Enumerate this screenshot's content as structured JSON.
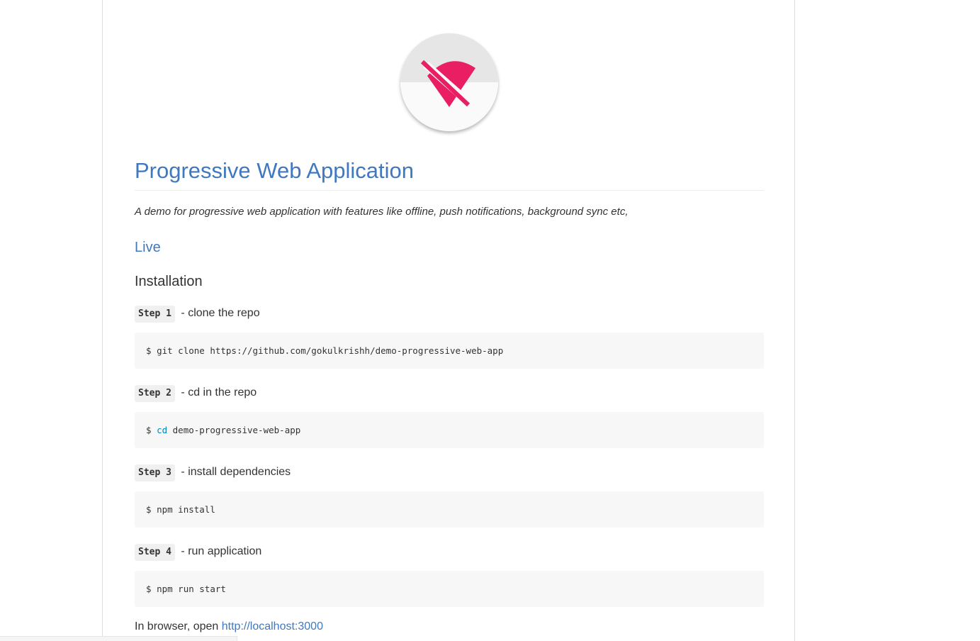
{
  "readme": {
    "title": "Progressive Web Application",
    "tagline": "A demo for progressive web application with features like offline, push notifications, background sync etc,",
    "live_link": "Live",
    "installation_heading": "Installation"
  },
  "logo": {
    "icon": "wifi-off-icon",
    "accent_color": "#e91e63",
    "background_top": "#e6e6e6",
    "background_bottom": "#fafafa"
  },
  "steps": [
    {
      "label": "Step 1",
      "description": " - clone the repo",
      "code_prompt": "$ ",
      "code_command": "git clone https://github.com/gokulkrishh/demo-progressive-web-app",
      "code_args": ""
    },
    {
      "label": "Step 2",
      "description": " - cd in the repo",
      "code_prompt": "$ ",
      "code_command": "cd",
      "code_args": " demo-progressive-web-app"
    },
    {
      "label": "Step 3",
      "description": " - install dependencies",
      "code_prompt": "$ ",
      "code_command": "npm install",
      "code_args": ""
    },
    {
      "label": "Step 4",
      "description": " - run application",
      "code_prompt": "$ ",
      "code_command": "npm run start",
      "code_args": ""
    }
  ],
  "browser": {
    "text": "In browser, open ",
    "link": "http://localhost:3000"
  },
  "colors": {
    "link": "#4078c0",
    "code_background": "#f7f7f7",
    "shell_builtin": "#0086b3"
  }
}
